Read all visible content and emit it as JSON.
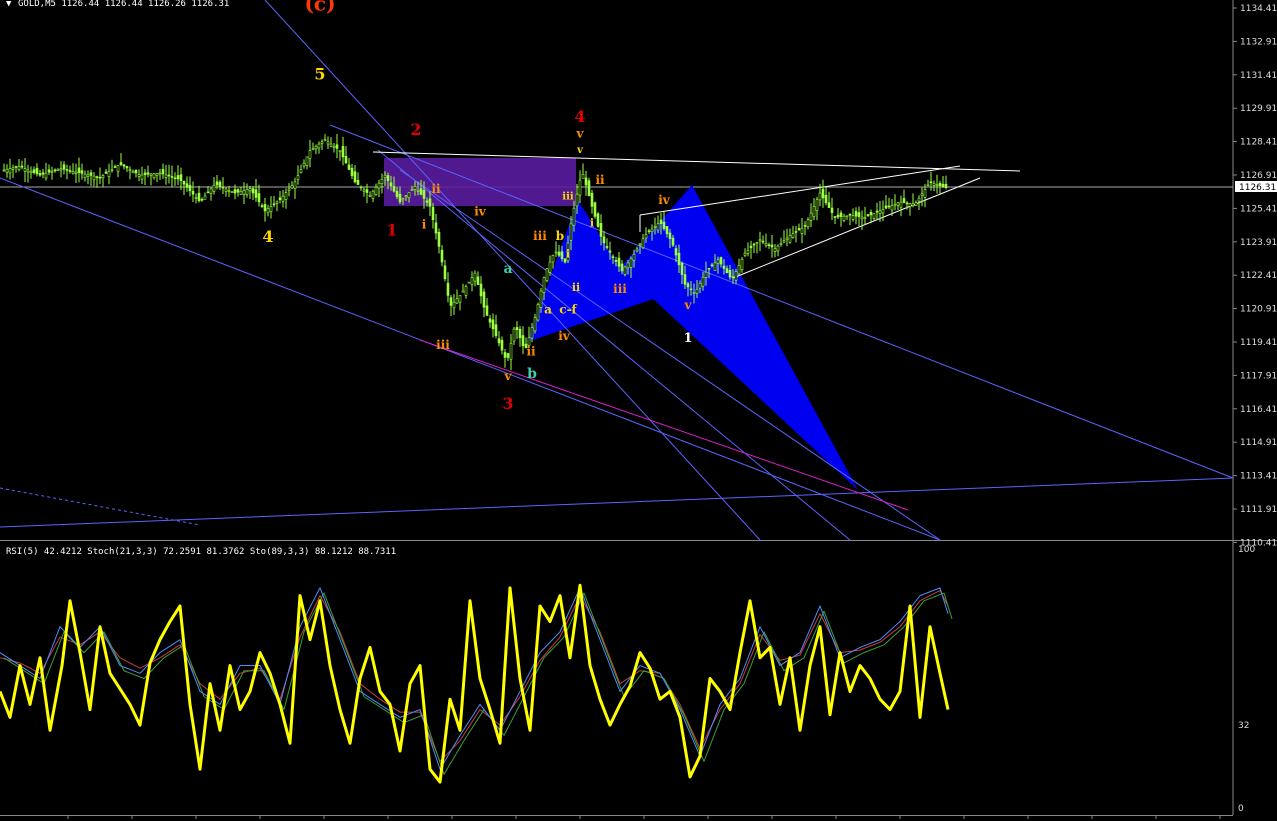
{
  "window": {
    "symbol_header": "GOLD,M5  1126.44 1126.44 1126.26 1126.31",
    "indicator_header": "RSI(5) 42.4212  Stoch(21,3,3) 72.2591 81.3762  Sto(89,3,3) 88.1212 88.7311"
  },
  "chart_data": [
    {
      "type": "candlestick",
      "price_axis": {
        "ticks": [
          "1134.41",
          "1132.91",
          "1131.41",
          "1129.91",
          "1128.41",
          "1126.91",
          "1125.41",
          "1123.91",
          "1122.41",
          "1120.91",
          "1119.41",
          "1117.91",
          "1116.41",
          "1114.91",
          "1113.41",
          "1111.91",
          "1110.41"
        ],
        "ylim": [
          1110.0,
          1134.8
        ],
        "current_price": "1126.31"
      },
      "price_path": [
        [
          0,
          1127.1
        ],
        [
          20,
          1127.3
        ],
        [
          40,
          1126.9
        ],
        [
          60,
          1127.2
        ],
        [
          80,
          1127.0
        ],
        [
          100,
          1126.8
        ],
        [
          120,
          1127.4
        ],
        [
          140,
          1126.9
        ],
        [
          160,
          1127.0
        ],
        [
          180,
          1126.7
        ],
        [
          200,
          1125.7
        ],
        [
          215,
          1126.5
        ],
        [
          235,
          1126.1
        ],
        [
          250,
          1126.3
        ],
        [
          265,
          1125.3
        ],
        [
          280,
          1125.8
        ],
        [
          295,
          1126.6
        ],
        [
          310,
          1128.0
        ],
        [
          325,
          1128.5
        ],
        [
          340,
          1128.0
        ],
        [
          355,
          1126.6
        ],
        [
          370,
          1126.0
        ],
        [
          385,
          1126.9
        ],
        [
          400,
          1125.7
        ],
        [
          415,
          1126.4
        ],
        [
          430,
          1125.5
        ],
        [
          440,
          1123.5
        ],
        [
          450,
          1121.0
        ],
        [
          460,
          1121.5
        ],
        [
          475,
          1122.5
        ],
        [
          485,
          1120.8
        ],
        [
          495,
          1119.8
        ],
        [
          507,
          1118.5
        ],
        [
          515,
          1120.2
        ],
        [
          525,
          1119.0
        ],
        [
          535,
          1120.5
        ],
        [
          545,
          1122.5
        ],
        [
          555,
          1123.5
        ],
        [
          565,
          1123.0
        ],
        [
          572,
          1125.0
        ],
        [
          582,
          1127.1
        ],
        [
          592,
          1125.5
        ],
        [
          602,
          1124.0
        ],
        [
          612,
          1123.3
        ],
        [
          622,
          1122.6
        ],
        [
          632,
          1123.2
        ],
        [
          645,
          1124.2
        ],
        [
          660,
          1124.8
        ],
        [
          672,
          1123.9
        ],
        [
          685,
          1122.0
        ],
        [
          695,
          1121.6
        ],
        [
          705,
          1122.5
        ],
        [
          718,
          1123.1
        ],
        [
          732,
          1122.2
        ],
        [
          745,
          1123.4
        ],
        [
          760,
          1124.0
        ],
        [
          775,
          1123.6
        ],
        [
          790,
          1124.2
        ],
        [
          805,
          1124.6
        ],
        [
          820,
          1126.1
        ],
        [
          835,
          1125.0
        ],
        [
          850,
          1125.1
        ],
        [
          865,
          1125.0
        ],
        [
          880,
          1125.3
        ],
        [
          900,
          1125.7
        ],
        [
          915,
          1125.6
        ],
        [
          930,
          1126.6
        ],
        [
          942,
          1126.4
        ],
        [
          948,
          1126.31
        ]
      ],
      "wave_labels": [
        {
          "text": "(c)",
          "x": 320,
          "price": 1134.3,
          "color": "#ff3a00",
          "size": 20
        },
        {
          "text": "5",
          "x": 320,
          "price": 1131.2,
          "color": "#ffd700",
          "size": 16
        },
        {
          "text": "4",
          "x": 268,
          "price": 1123.9,
          "color": "#ffd700",
          "size": 16
        },
        {
          "text": "2",
          "x": 416,
          "price": 1128.7,
          "color": "#e00000",
          "size": 16
        },
        {
          "text": "1",
          "x": 392,
          "price": 1124.2,
          "color": "#e00000",
          "size": 16
        },
        {
          "text": "ii",
          "x": 436,
          "price": 1126.1,
          "color": "#ff8c00",
          "size": 12
        },
        {
          "text": "i",
          "x": 424,
          "price": 1124.5,
          "color": "#ff8c00",
          "size": 12
        },
        {
          "text": "iv",
          "x": 480,
          "price": 1125.1,
          "color": "#ff8c00",
          "size": 12
        },
        {
          "text": "iii",
          "x": 443,
          "price": 1119.1,
          "color": "#ff8c00",
          "size": 12
        },
        {
          "text": "a",
          "x": 508,
          "price": 1122.5,
          "color": "#40d0b0",
          "size": 14
        },
        {
          "text": "v",
          "x": 508,
          "price": 1117.7,
          "color": "#ff8c00",
          "size": 12
        },
        {
          "text": "b",
          "x": 532,
          "price": 1117.8,
          "color": "#40d0b0",
          "size": 14
        },
        {
          "text": "3",
          "x": 508,
          "price": 1116.4,
          "color": "#e00000",
          "size": 16
        },
        {
          "text": "iii",
          "x": 540,
          "price": 1124.0,
          "color": "#ff8c00",
          "size": 12
        },
        {
          "text": "b",
          "x": 560,
          "price": 1124.0,
          "color": "#ffd700",
          "size": 12
        },
        {
          "text": "i",
          "x": 568,
          "price": 1123.2,
          "color": "#ffd700",
          "size": 11
        },
        {
          "text": "iii",
          "x": 568,
          "price": 1125.8,
          "color": "#ffd700",
          "size": 10
        },
        {
          "text": "ii",
          "x": 576,
          "price": 1121.7,
          "color": "#ffd700",
          "size": 11
        },
        {
          "text": "a",
          "x": 548,
          "price": 1120.7,
          "color": "#ffd700",
          "size": 12
        },
        {
          "text": "c-f",
          "x": 568,
          "price": 1120.7,
          "color": "#ffd700",
          "size": 12
        },
        {
          "text": "iv",
          "x": 564,
          "price": 1119.5,
          "color": "#ff8c00",
          "size": 12
        },
        {
          "text": "ii",
          "x": 531,
          "price": 1118.8,
          "color": "#ff8c00",
          "size": 12
        },
        {
          "text": "4",
          "x": 580,
          "price": 1129.3,
          "color": "#e00000",
          "size": 16
        },
        {
          "text": "v",
          "x": 580,
          "price": 1128.6,
          "color": "#ff8c00",
          "size": 12
        },
        {
          "text": "v",
          "x": 580,
          "price": 1127.9,
          "color": "#ffd700",
          "size": 10
        },
        {
          "text": "ii",
          "x": 600,
          "price": 1126.5,
          "color": "#ff8c00",
          "size": 12
        },
        {
          "text": "i",
          "x": 592,
          "price": 1124.6,
          "color": "#ffd700",
          "size": 11
        },
        {
          "text": "iii",
          "x": 620,
          "price": 1121.6,
          "color": "#ff8c00",
          "size": 12
        },
        {
          "text": "iv",
          "x": 664,
          "price": 1125.6,
          "color": "#ff8c00",
          "size": 12
        },
        {
          "text": "v",
          "x": 688,
          "price": 1120.9,
          "color": "#ff8c00",
          "size": 12
        },
        {
          "text": "1",
          "x": 688,
          "price": 1119.4,
          "color": "#ffffff",
          "size": 13
        }
      ],
      "colors": {
        "candles": "#9aff40",
        "grid_axis": "#888888",
        "trendlines": "#5a64ff",
        "channel": "#ffffff",
        "pattern": "#0000f0",
        "box": "#5a1c9e",
        "magenta": "#e020d0"
      }
    },
    {
      "type": "line",
      "indicator_axis": {
        "ticks": [
          "100",
          "32",
          "0"
        ],
        "ylim": [
          0,
          100
        ]
      },
      "rsi": [
        [
          0,
          45
        ],
        [
          10,
          35
        ],
        [
          20,
          55
        ],
        [
          30,
          40
        ],
        [
          40,
          58
        ],
        [
          50,
          30
        ],
        [
          62,
          55
        ],
        [
          70,
          80
        ],
        [
          80,
          60
        ],
        [
          90,
          38
        ],
        [
          100,
          70
        ],
        [
          110,
          52
        ],
        [
          120,
          46
        ],
        [
          130,
          40
        ],
        [
          140,
          32
        ],
        [
          150,
          56
        ],
        [
          160,
          65
        ],
        [
          170,
          72
        ],
        [
          180,
          78
        ],
        [
          190,
          40
        ],
        [
          200,
          15
        ],
        [
          210,
          48
        ],
        [
          220,
          30
        ],
        [
          230,
          55
        ],
        [
          240,
          38
        ],
        [
          250,
          45
        ],
        [
          260,
          60
        ],
        [
          270,
          52
        ],
        [
          280,
          40
        ],
        [
          290,
          25
        ],
        [
          300,
          82
        ],
        [
          310,
          65
        ],
        [
          320,
          80
        ],
        [
          330,
          55
        ],
        [
          340,
          38
        ],
        [
          350,
          25
        ],
        [
          360,
          50
        ],
        [
          370,
          62
        ],
        [
          380,
          45
        ],
        [
          390,
          40
        ],
        [
          400,
          22
        ],
        [
          410,
          48
        ],
        [
          420,
          55
        ],
        [
          430,
          15
        ],
        [
          440,
          10
        ],
        [
          450,
          42
        ],
        [
          460,
          30
        ],
        [
          470,
          80
        ],
        [
          480,
          50
        ],
        [
          490,
          38
        ],
        [
          500,
          25
        ],
        [
          510,
          85
        ],
        [
          520,
          50
        ],
        [
          530,
          30
        ],
        [
          540,
          78
        ],
        [
          550,
          72
        ],
        [
          560,
          82
        ],
        [
          570,
          58
        ],
        [
          580,
          86
        ],
        [
          590,
          55
        ],
        [
          600,
          42
        ],
        [
          610,
          32
        ],
        [
          620,
          40
        ],
        [
          630,
          47
        ],
        [
          640,
          60
        ],
        [
          650,
          54
        ],
        [
          660,
          42
        ],
        [
          670,
          45
        ],
        [
          680,
          35
        ],
        [
          690,
          12
        ],
        [
          700,
          20
        ],
        [
          710,
          50
        ],
        [
          720,
          45
        ],
        [
          730,
          38
        ],
        [
          740,
          60
        ],
        [
          750,
          80
        ],
        [
          760,
          58
        ],
        [
          770,
          62
        ],
        [
          780,
          40
        ],
        [
          790,
          58
        ],
        [
          800,
          30
        ],
        [
          810,
          55
        ],
        [
          820,
          70
        ],
        [
          830,
          36
        ],
        [
          840,
          60
        ],
        [
          850,
          45
        ],
        [
          860,
          55
        ],
        [
          870,
          50
        ],
        [
          880,
          42
        ],
        [
          890,
          38
        ],
        [
          900,
          45
        ],
        [
          910,
          78
        ],
        [
          920,
          35
        ],
        [
          930,
          70
        ],
        [
          940,
          52
        ],
        [
          948,
          38
        ]
      ],
      "stoch_fast": [
        [
          0,
          60
        ],
        [
          20,
          55
        ],
        [
          40,
          50
        ],
        [
          60,
          70
        ],
        [
          80,
          62
        ],
        [
          100,
          70
        ],
        [
          120,
          55
        ],
        [
          140,
          52
        ],
        [
          160,
          60
        ],
        [
          180,
          65
        ],
        [
          200,
          45
        ],
        [
          220,
          40
        ],
        [
          240,
          55
        ],
        [
          260,
          55
        ],
        [
          280,
          40
        ],
        [
          300,
          70
        ],
        [
          320,
          85
        ],
        [
          340,
          65
        ],
        [
          360,
          45
        ],
        [
          380,
          40
        ],
        [
          400,
          35
        ],
        [
          420,
          38
        ],
        [
          440,
          15
        ],
        [
          460,
          28
        ],
        [
          480,
          40
        ],
        [
          500,
          30
        ],
        [
          520,
          45
        ],
        [
          540,
          60
        ],
        [
          560,
          68
        ],
        [
          580,
          85
        ],
        [
          600,
          65
        ],
        [
          620,
          45
        ],
        [
          640,
          55
        ],
        [
          660,
          52
        ],
        [
          680,
          38
        ],
        [
          700,
          20
        ],
        [
          720,
          40
        ],
        [
          740,
          50
        ],
        [
          760,
          70
        ],
        [
          780,
          55
        ],
        [
          800,
          60
        ],
        [
          820,
          78
        ],
        [
          840,
          58
        ],
        [
          860,
          62
        ],
        [
          880,
          65
        ],
        [
          900,
          72
        ],
        [
          920,
          82
        ],
        [
          940,
          85
        ],
        [
          948,
          75
        ]
      ],
      "stoch_slow": [
        [
          0,
          58
        ],
        [
          20,
          56
        ],
        [
          40,
          52
        ],
        [
          60,
          66
        ],
        [
          80,
          63
        ],
        [
          100,
          68
        ],
        [
          120,
          58
        ],
        [
          140,
          54
        ],
        [
          160,
          58
        ],
        [
          180,
          63
        ],
        [
          200,
          48
        ],
        [
          220,
          42
        ],
        [
          240,
          52
        ],
        [
          260,
          54
        ],
        [
          280,
          42
        ],
        [
          300,
          66
        ],
        [
          320,
          82
        ],
        [
          340,
          68
        ],
        [
          360,
          48
        ],
        [
          380,
          42
        ],
        [
          400,
          37
        ],
        [
          420,
          37
        ],
        [
          440,
          18
        ],
        [
          460,
          26
        ],
        [
          480,
          38
        ],
        [
          500,
          32
        ],
        [
          520,
          43
        ],
        [
          540,
          57
        ],
        [
          560,
          66
        ],
        [
          580,
          82
        ],
        [
          600,
          68
        ],
        [
          620,
          48
        ],
        [
          640,
          53
        ],
        [
          660,
          52
        ],
        [
          680,
          40
        ],
        [
          700,
          23
        ],
        [
          720,
          38
        ],
        [
          740,
          48
        ],
        [
          760,
          67
        ],
        [
          780,
          57
        ],
        [
          800,
          59
        ],
        [
          820,
          75
        ],
        [
          840,
          60
        ],
        [
          860,
          61
        ],
        [
          880,
          64
        ],
        [
          900,
          70
        ],
        [
          920,
          80
        ],
        [
          940,
          84
        ],
        [
          948,
          78
        ]
      ]
    }
  ]
}
